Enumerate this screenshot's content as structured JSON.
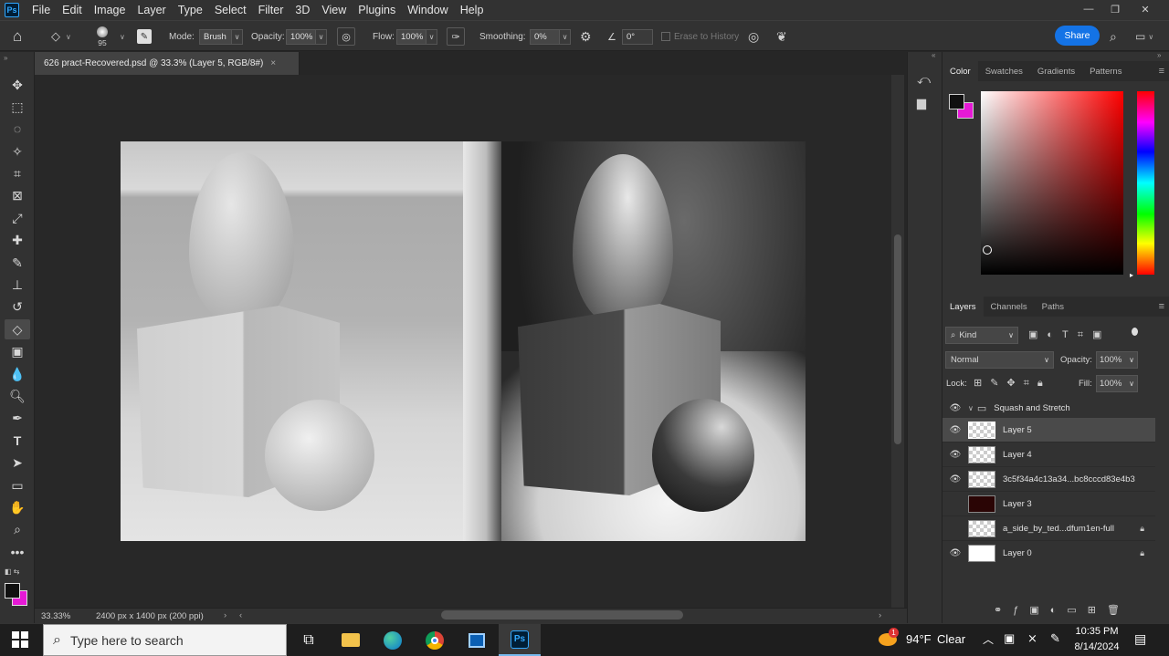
{
  "menubar": {
    "logo": "Ps",
    "items": [
      "File",
      "Edit",
      "Image",
      "Layer",
      "Type",
      "Select",
      "Filter",
      "3D",
      "View",
      "Plugins",
      "Window",
      "Help"
    ],
    "window_controls": {
      "minimize": "—",
      "restore": "❐",
      "close": "✕"
    }
  },
  "options_bar": {
    "brush_size": "95",
    "mode_label": "Mode:",
    "mode_value": "Brush",
    "opacity_label": "Opacity:",
    "opacity_value": "100%",
    "flow_label": "Flow:",
    "flow_value": "100%",
    "smoothing_label": "Smoothing:",
    "smoothing_value": "0%",
    "angle_value": "0°",
    "erase_history_label": "Erase to History",
    "share_label": "Share"
  },
  "document_tab": {
    "title": "626 pract-Recovered.psd @ 33.3% (Layer 5, RGB/8#)",
    "close": "×"
  },
  "status_bar": {
    "zoom": "33.33%",
    "dimensions": "2400 px x 1400 px (200 ppi)"
  },
  "color_panel": {
    "tabs": [
      "Color",
      "Swatches",
      "Gradients",
      "Patterns"
    ],
    "active_tab": "Color",
    "foreground": "#101010",
    "background": "#e619d6"
  },
  "layers_panel": {
    "tabs": [
      "Layers",
      "Channels",
      "Paths"
    ],
    "filter_kind": "Kind",
    "blend_mode": "Normal",
    "opacity_label": "Opacity:",
    "opacity_value": "100%",
    "lock_label": "Lock:",
    "fill_label": "Fill:",
    "fill_value": "100%",
    "layers": [
      {
        "name": "Squash and Stretch",
        "type": "group",
        "visible": true
      },
      {
        "name": "Layer 5",
        "visible": true,
        "selected": true
      },
      {
        "name": "Layer 4",
        "visible": true
      },
      {
        "name": "3c5f34a4c13a34...bc8cccd83e4b3",
        "visible": true
      },
      {
        "name": "Layer 3",
        "visible": false
      },
      {
        "name": "a_side_by_ted...dfum1en-full",
        "visible": false,
        "locked": true
      },
      {
        "name": "Layer 0",
        "visible": true,
        "locked": true
      }
    ]
  },
  "taskbar": {
    "search_placeholder": "Type here to search",
    "weather_temp": "94°F",
    "weather_desc": "Clear",
    "time": "10:35 PM",
    "date": "8/14/2024",
    "weather_badge": "1"
  }
}
